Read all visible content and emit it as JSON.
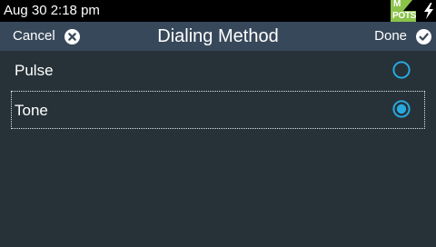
{
  "status_bar": {
    "time": "Aug 30 2:18 pm",
    "network_logo": {
      "top_letter": "M",
      "label": "POTS",
      "color": "#8bc34a"
    },
    "power_icon": "lightning-bolt-icon"
  },
  "header": {
    "title": "Dialing Method",
    "cancel_label": "Cancel",
    "cancel_icon": "close-circle-icon",
    "done_label": "Done",
    "done_icon": "check-circle-icon",
    "background": "#37485a"
  },
  "options": [
    {
      "label": "Pulse",
      "selected": false
    },
    {
      "label": "Tone",
      "selected": true
    }
  ],
  "colors": {
    "background": "#263238",
    "accent": "#29a8e0",
    "status_bar": "#000000"
  }
}
